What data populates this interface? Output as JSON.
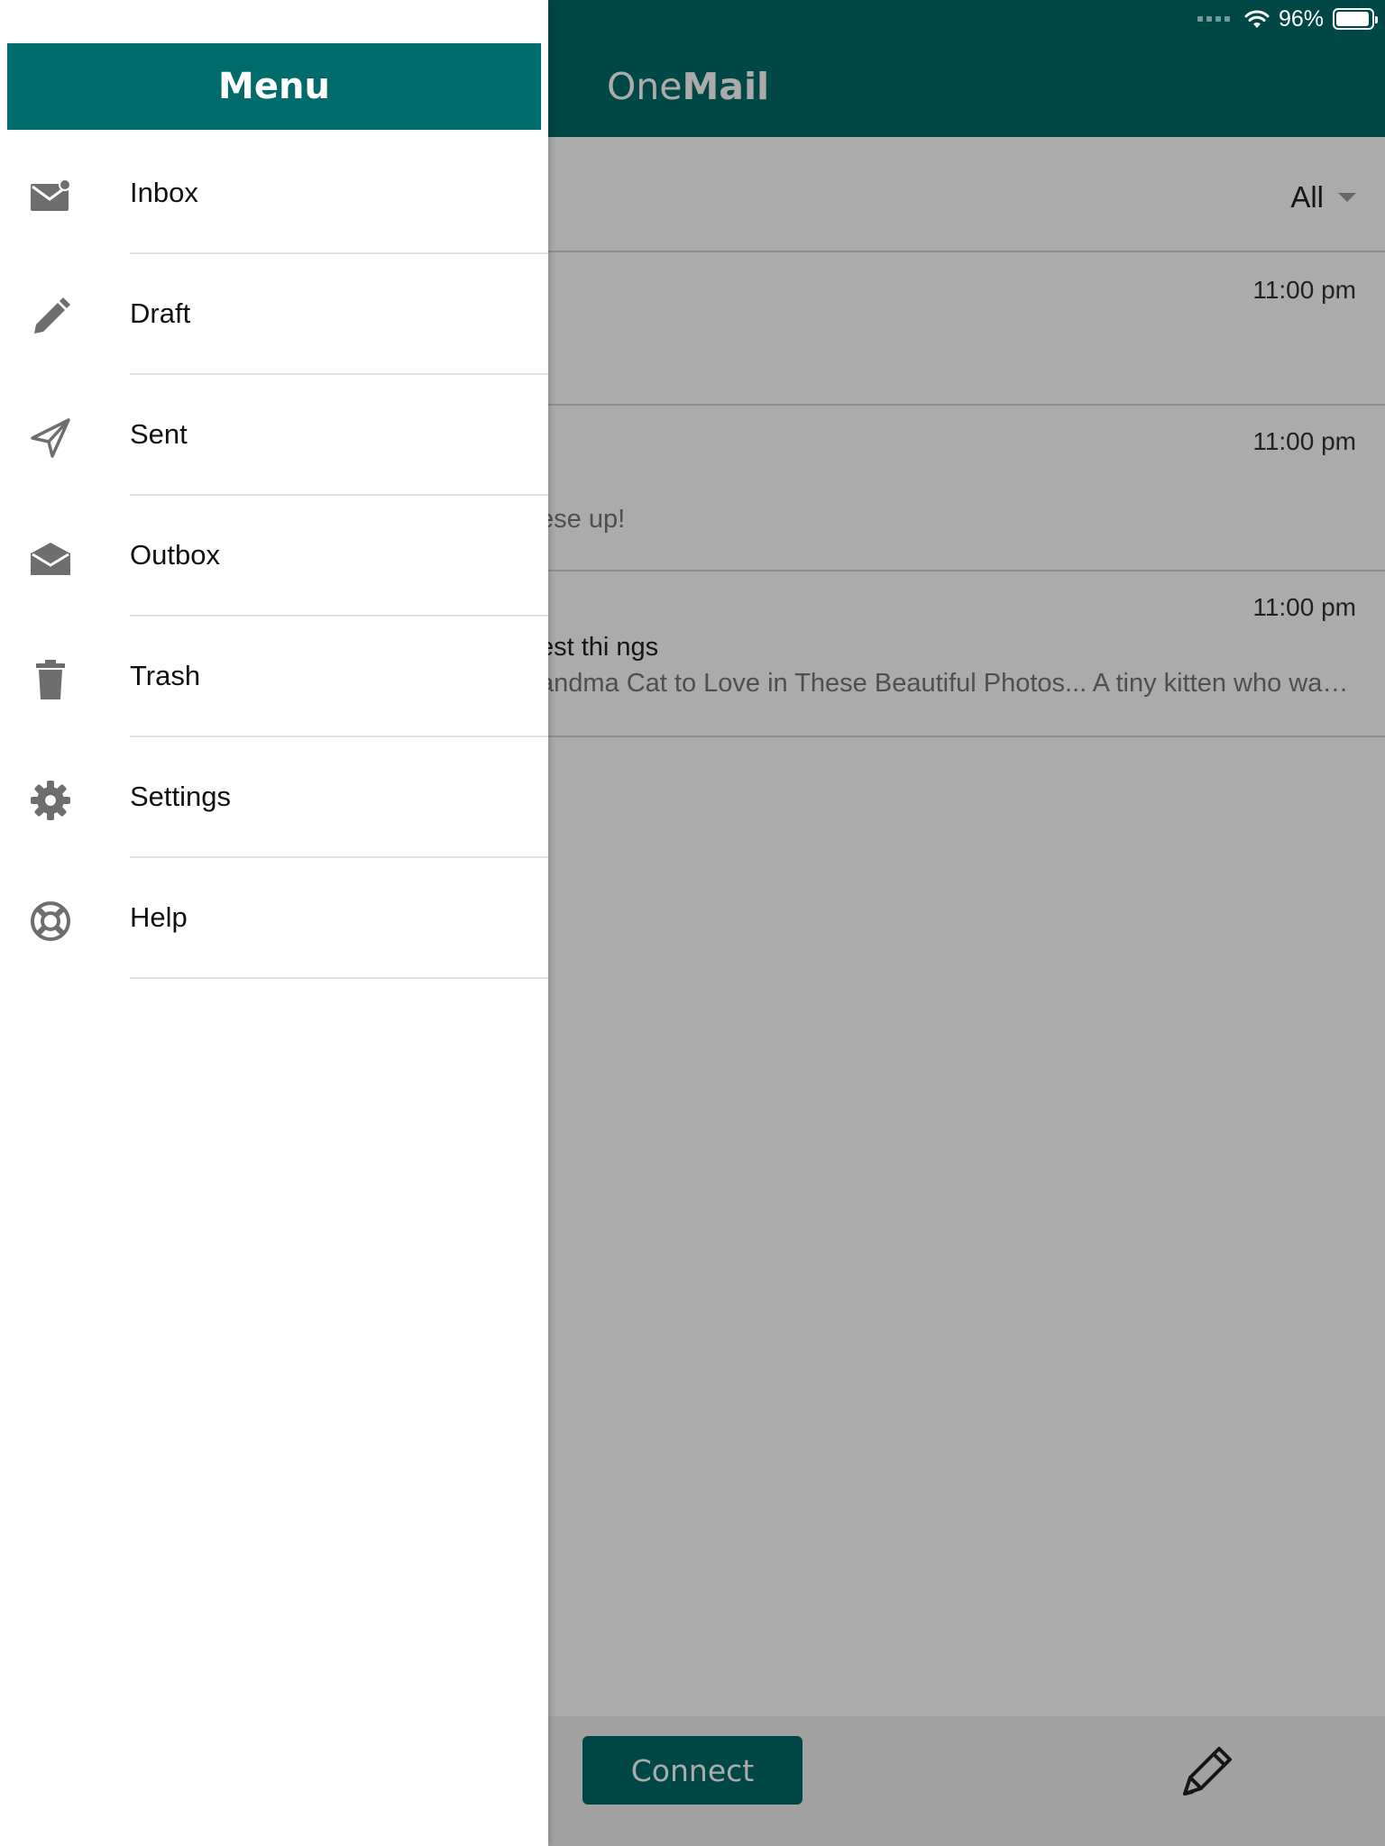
{
  "status_bar": {
    "wifi_icon": "wifi-icon",
    "battery_percent": "96%",
    "battery_level": 0.96
  },
  "app": {
    "brand_light": "One",
    "brand_bold": "Mail",
    "filter": {
      "selected": "All"
    },
    "mails": [
      {
        "time": "11:00 pm",
        "subject": "",
        "preview": ""
      },
      {
        "time": "11:00 pm",
        "subject": "",
        "preview": "ese up!"
      },
      {
        "time": "11:00 pm",
        "subject": "est thi ngs",
        "preview": "andma Cat to Love in These Beautiful Photos... A tiny kitten who was fou..."
      }
    ],
    "connect_label": "Connect",
    "compose_icon": "pencil-icon"
  },
  "drawer": {
    "title": "Menu",
    "items": [
      {
        "label": "Inbox",
        "icon": "mail-icon"
      },
      {
        "label": "Draft",
        "icon": "pencil-icon"
      },
      {
        "label": "Sent",
        "icon": "send-icon"
      },
      {
        "label": "Outbox",
        "icon": "open-mail-icon"
      },
      {
        "label": "Trash",
        "icon": "trash-icon"
      },
      {
        "label": "Settings",
        "icon": "gear-icon"
      },
      {
        "label": "Help",
        "icon": "lifebuoy-icon"
      }
    ]
  },
  "colors": {
    "primary": "#006b6b",
    "icon_gray": "#6e6e6e",
    "divider": "#e0e0e0"
  }
}
